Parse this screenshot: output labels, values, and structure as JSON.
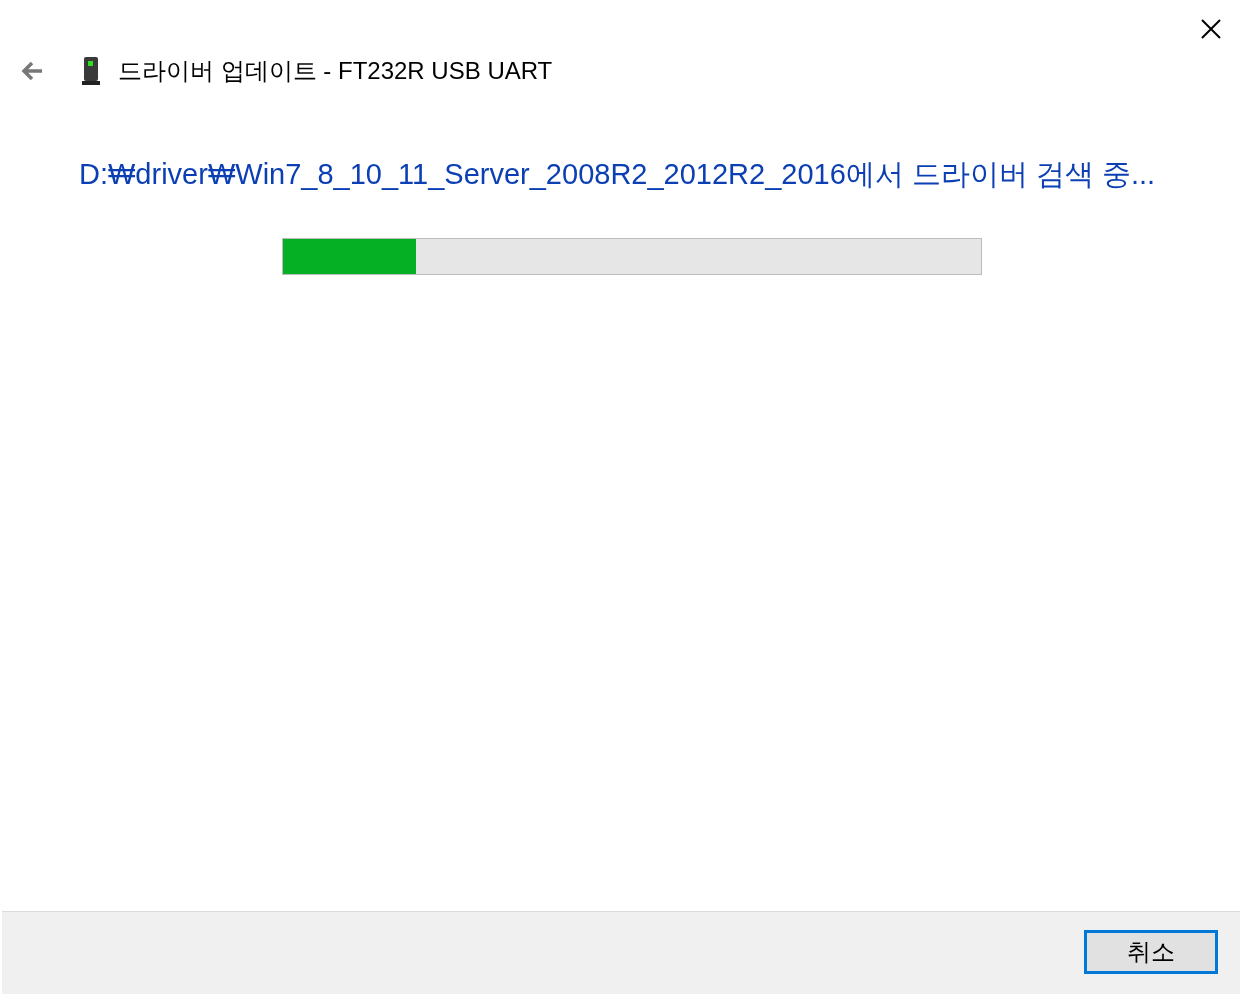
{
  "window": {
    "title": "드라이버 업데이트 - FT232R USB UART"
  },
  "status": {
    "message": "D:₩driver₩Win7_8_10_11_Server_2008R2_2012R2_2016에서 드라이버 검색 중..."
  },
  "progress": {
    "level": 0.19
  },
  "buttons": [
    {
      "label": "취소",
      "focused": true
    }
  ]
}
